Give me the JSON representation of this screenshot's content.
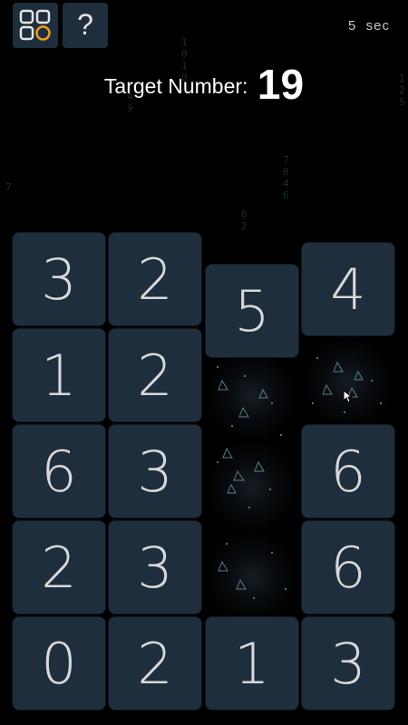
{
  "header": {
    "menu_icon": "grid-menu-icon",
    "help_label": "?",
    "timer_value": "5",
    "timer_unit": "sec"
  },
  "target": {
    "label": "Target Number:",
    "value": "19"
  },
  "board": {
    "columns": [
      [
        "3",
        "1",
        "6",
        "2",
        "0"
      ],
      [
        "2",
        "2",
        "3",
        "3",
        "2"
      ],
      [
        "5",
        "",
        "",
        "",
        "1"
      ],
      [
        "4",
        "",
        "6",
        "6",
        "3"
      ]
    ]
  },
  "colors": {
    "tile_bg": "#1f2e3c",
    "tile_text": "#d8d8d8",
    "menu_accent": "#f0a020",
    "background": "#000000"
  }
}
